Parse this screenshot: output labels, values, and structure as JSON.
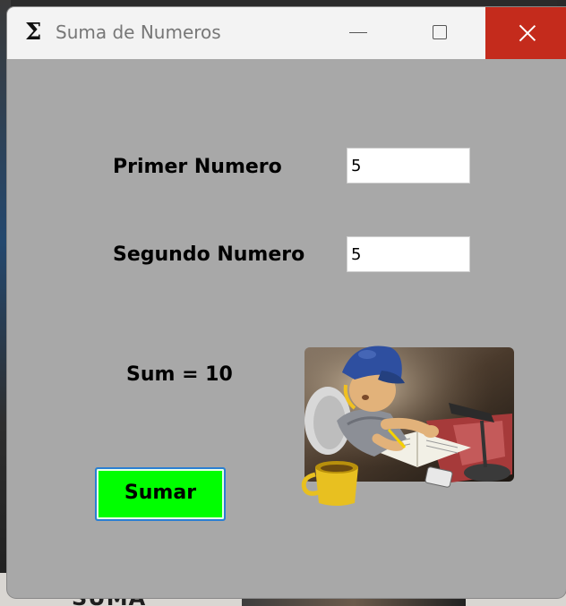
{
  "window": {
    "title": "Suma de Numeros",
    "icon": "sigma-icon"
  },
  "titlebar": {
    "minimize_icon": "minimize-icon",
    "maximize_icon": "maximize-icon",
    "close_icon": "close-icon",
    "close_color": "#c42b1c"
  },
  "form": {
    "primer_label": "Primer Numero",
    "primer_value": "5",
    "segundo_label": "Segundo Numero",
    "segundo_value": "5",
    "sum_text": "Sum = 10",
    "button_label": "Sumar",
    "button_color": "#00ff00"
  },
  "illustration": {
    "icon": "student-studying-image"
  },
  "background": {
    "partial_label": "SUMA"
  }
}
